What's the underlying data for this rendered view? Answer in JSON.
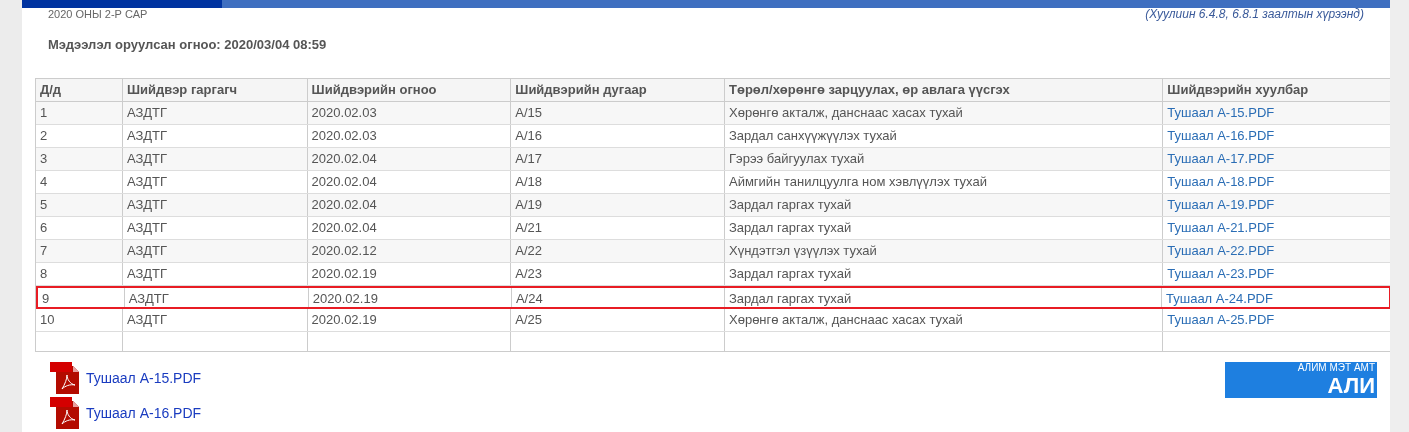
{
  "header": {
    "period": "2020 ОНЫ 2-Р САР",
    "legal_note": "(Хуулиин 6.4.8, 6.8.1 заалтын хүрээнд)",
    "entry_date": "Мэдээлэл оруулсан огноо: 2020/03/04 08:59"
  },
  "table": {
    "columns": [
      "Д/д",
      "Шийдвэр гаргагч",
      "Шийдвэрийн огноо",
      "Шийдвэрийн дугаар",
      "Төрөл/хөрөнгө зарцуулах, өр авлага үүсгэх",
      "Шийдвэрийн хуулбар"
    ],
    "rows": [
      {
        "cells": [
          "1",
          "АЗДТГ",
          "2020.02.03",
          "А/15",
          "Хөрөнгө акталж, данснаас хасах тухай"
        ],
        "file": "Тушаал А-15.PDF",
        "highlighted": false
      },
      {
        "cells": [
          "2",
          "АЗДТГ",
          "2020.02.03",
          "А/16",
          "Зардал санхүүжүүлэх тухай"
        ],
        "file": "Тушаал А-16.PDF",
        "highlighted": false
      },
      {
        "cells": [
          "3",
          "АЗДТГ",
          "2020.02.04",
          "А/17",
          "Гэрээ байгуулах тухай"
        ],
        "file": "Тушаал А-17.PDF",
        "highlighted": false
      },
      {
        "cells": [
          "4",
          "АЗДТГ",
          "2020.02.04",
          "А/18",
          "Аймгийн танилцуулга ном хэвлүүлэх тухай"
        ],
        "file": "Тушаал А-18.PDF",
        "highlighted": false
      },
      {
        "cells": [
          "5",
          "АЗДТГ",
          "2020.02.04",
          "А/19",
          "Зардал гаргах тухай"
        ],
        "file": "Тушаал А-19.PDF",
        "highlighted": false
      },
      {
        "cells": [
          "6",
          "АЗДТГ",
          "2020.02.04",
          "А/21",
          "Зардал гаргах тухай"
        ],
        "file": "Тушаал А-21.PDF",
        "highlighted": false
      },
      {
        "cells": [
          "7",
          "АЗДТГ",
          "2020.02.12",
          "А/22",
          "Хүндэтгэл үзүүлэх тухай"
        ],
        "file": "Тушаал А-22.PDF",
        "highlighted": false
      },
      {
        "cells": [
          "8",
          "АЗДТГ",
          "2020.02.19",
          "А/23",
          "Зардал гаргах тухай"
        ],
        "file": "Тушаал А-23.PDF",
        "highlighted": false
      },
      {
        "cells": [
          "9",
          "АЗДТГ",
          "2020.02.19",
          "А/24",
          "Зардал гаргах тухай"
        ],
        "file": "Тушаал А-24.PDF",
        "highlighted": true
      },
      {
        "cells": [
          "10",
          "АЗДТГ",
          "2020.02.19",
          "А/25",
          "Хөрөнгө акталж, данснаас хасах тухай"
        ],
        "file": "Тушаал А-25.PDF",
        "highlighted": false
      }
    ]
  },
  "attachments": [
    "Тушаал А-15.PDF",
    "Тушаал А-16.PDF"
  ],
  "banner": {
    "caption": "АЛИМ МЭТ АМТ",
    "headline": "АЛИ"
  }
}
